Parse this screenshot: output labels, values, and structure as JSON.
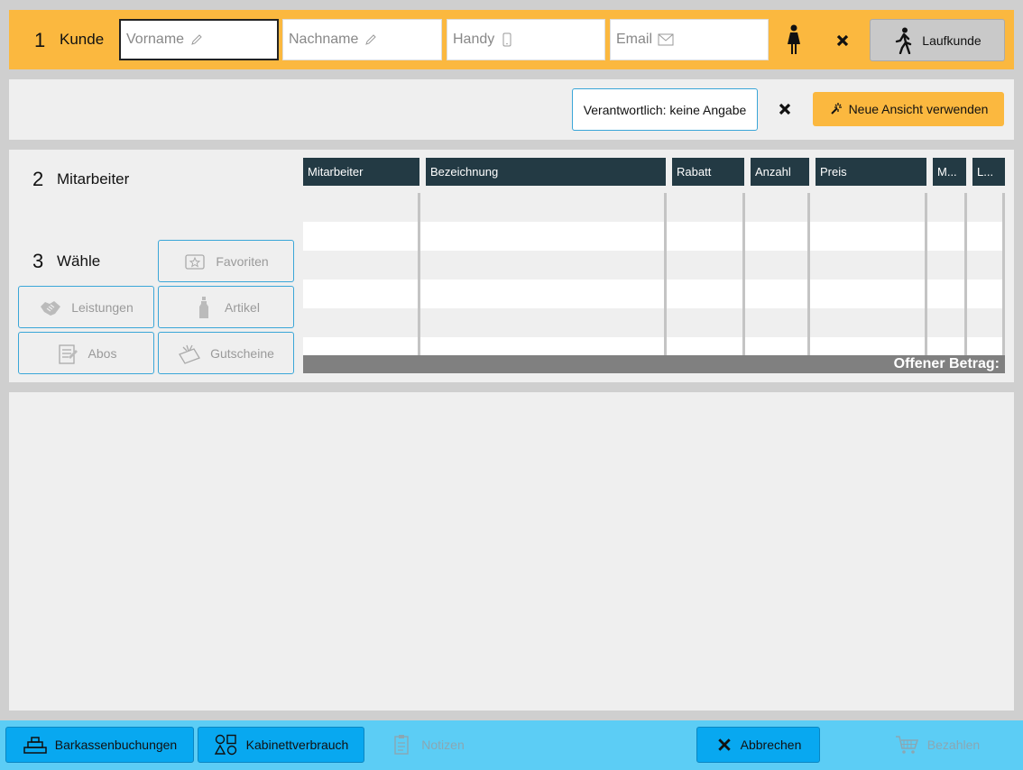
{
  "customer": {
    "step_number": "1",
    "step_label": "Kunde",
    "firstname_placeholder": "Vorname",
    "lastname_placeholder": "Nachname",
    "mobile_placeholder": "Handy",
    "email_placeholder": "Email",
    "walkin_label": "Laufkunde"
  },
  "view": {
    "responsible_label": "Verantwortlich: keine Angabe",
    "new_view_label": "Neue Ansicht verwenden"
  },
  "employee": {
    "step_number": "2",
    "step_label": "Mitarbeiter"
  },
  "choose": {
    "step_number": "3",
    "step_label": "Wähle",
    "buttons": [
      {
        "label": "Favoriten",
        "icon": "favorites-icon"
      },
      {
        "label": "Leistungen",
        "icon": "handshake-icon"
      },
      {
        "label": "Artikel",
        "icon": "bottle-icon"
      },
      {
        "label": "Abos",
        "icon": "subscription-icon"
      },
      {
        "label": "Gutscheine",
        "icon": "voucher-icon"
      }
    ]
  },
  "table": {
    "columns": [
      "Mitarbeiter",
      "Bezeichnung",
      "Rabatt",
      "Anzahl",
      "Preis",
      "M...",
      "L..."
    ],
    "footer_label": "Offener Betrag:"
  },
  "footer": {
    "cash_label": "Barkassenbuchungen",
    "cabinet_label": "Kabinettverbrauch",
    "notes_label": "Notizen",
    "cancel_label": "Abbrechen",
    "pay_label": "Bezahlen"
  },
  "colors": {
    "accent_orange": "#fbb83f",
    "header_dark": "#233a44",
    "footer_blue": "#5ccdf5",
    "button_blue": "#08a8f0"
  }
}
